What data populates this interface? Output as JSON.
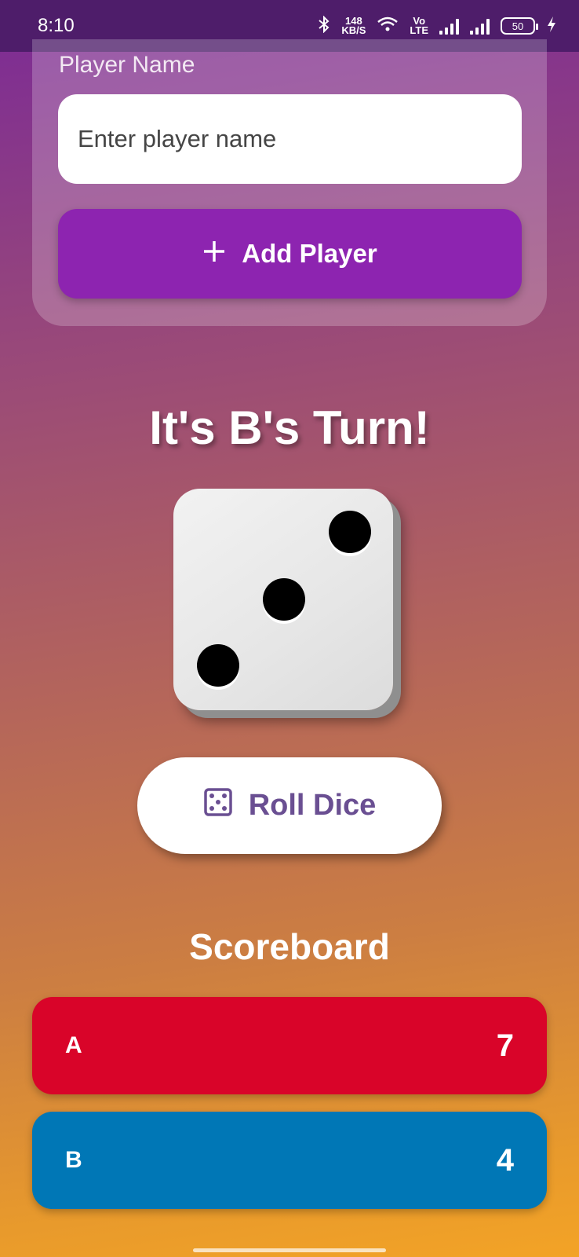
{
  "status_bar": {
    "time": "8:10",
    "net_speed_value": "148",
    "net_speed_unit": "KB/S",
    "volte_top": "Vo",
    "volte_bottom": "LTE",
    "battery_level": "50",
    "icons": [
      "bluetooth-icon",
      "wifi-icon",
      "signal-icon",
      "signal-icon",
      "battery-icon",
      "charging-icon"
    ]
  },
  "add_player": {
    "label": "Player Name",
    "input_placeholder": "Enter player name",
    "input_value": "",
    "button_label": "Add Player",
    "button_icon": "plus-icon"
  },
  "game": {
    "turn_text": "It's B's Turn!",
    "dice_value": 3,
    "roll_button_label": "Roll Dice",
    "roll_button_icon": "dice-icon"
  },
  "scoreboard": {
    "title": "Scoreboard",
    "players": [
      {
        "name": "A",
        "score": "7",
        "color": "#d90429"
      },
      {
        "name": "B",
        "score": "4",
        "color": "#0077b6"
      }
    ]
  },
  "colors": {
    "accent_purple": "#8d24b0",
    "roll_text": "#6a4f92",
    "status_bar": "#4e1d6a"
  }
}
